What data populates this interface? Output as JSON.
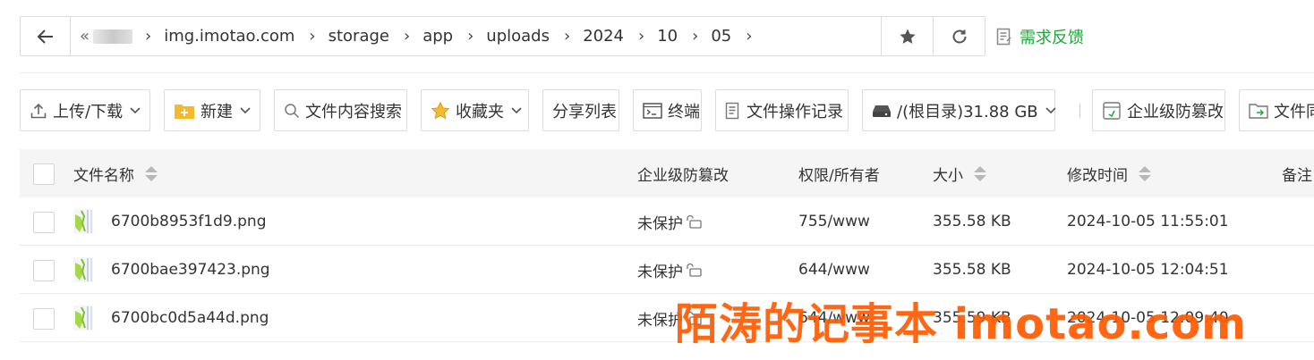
{
  "address_bar": {
    "crumbs": [
      "img.imotao.com",
      "storage",
      "app",
      "uploads",
      "2024",
      "10",
      "05"
    ]
  },
  "feedback_label": "需求反馈",
  "toolbar": {
    "upload_download": "上传/下载",
    "new": "新建",
    "content_search": "文件内容搜索",
    "favorites": "收藏夹",
    "share_list": "分享列表",
    "terminal": "终端",
    "operation_log": "文件操作记录",
    "disk": "/(根目录)31.88 GB",
    "tamper_protect": "企业级防篡改",
    "sync": "文件同"
  },
  "table": {
    "headers": {
      "name": "文件名称",
      "tamper": "企业级防篡改",
      "perm": "权限/所有者",
      "size": "大小",
      "mtime": "修改时间",
      "note": "备注"
    },
    "rows": [
      {
        "name": "6700b8953f1d9.png",
        "tamper": "未保护",
        "perm": "755/www",
        "size": "355.58 KB",
        "mtime": "2024-10-05 11:55:01"
      },
      {
        "name": "6700bae397423.png",
        "tamper": "未保护",
        "perm": "644/www",
        "size": "355.58 KB",
        "mtime": "2024-10-05 12:04:51"
      },
      {
        "name": "6700bc0d5a44d.png",
        "tamper": "未保护",
        "perm": "644/www",
        "size": "355.59 KB",
        "mtime": "2024-10-05 12:09:40"
      }
    ]
  },
  "watermark": "陌涛的记事本 imotao.com",
  "colors": {
    "accent_green": "#20a53a",
    "watermark_orange": "#ff5a00",
    "folder_yellow": "#f5b82e"
  },
  "icons": [
    "back-arrow-icon",
    "chevron-right-icon",
    "star-icon",
    "refresh-icon",
    "feedback-icon",
    "upload-icon",
    "folder-plus-icon",
    "search-icon",
    "favorite-star-icon",
    "terminal-icon",
    "log-icon",
    "disk-icon",
    "shield-icon",
    "folder-sync-icon",
    "lock-open-icon",
    "image-thumb-icon"
  ]
}
